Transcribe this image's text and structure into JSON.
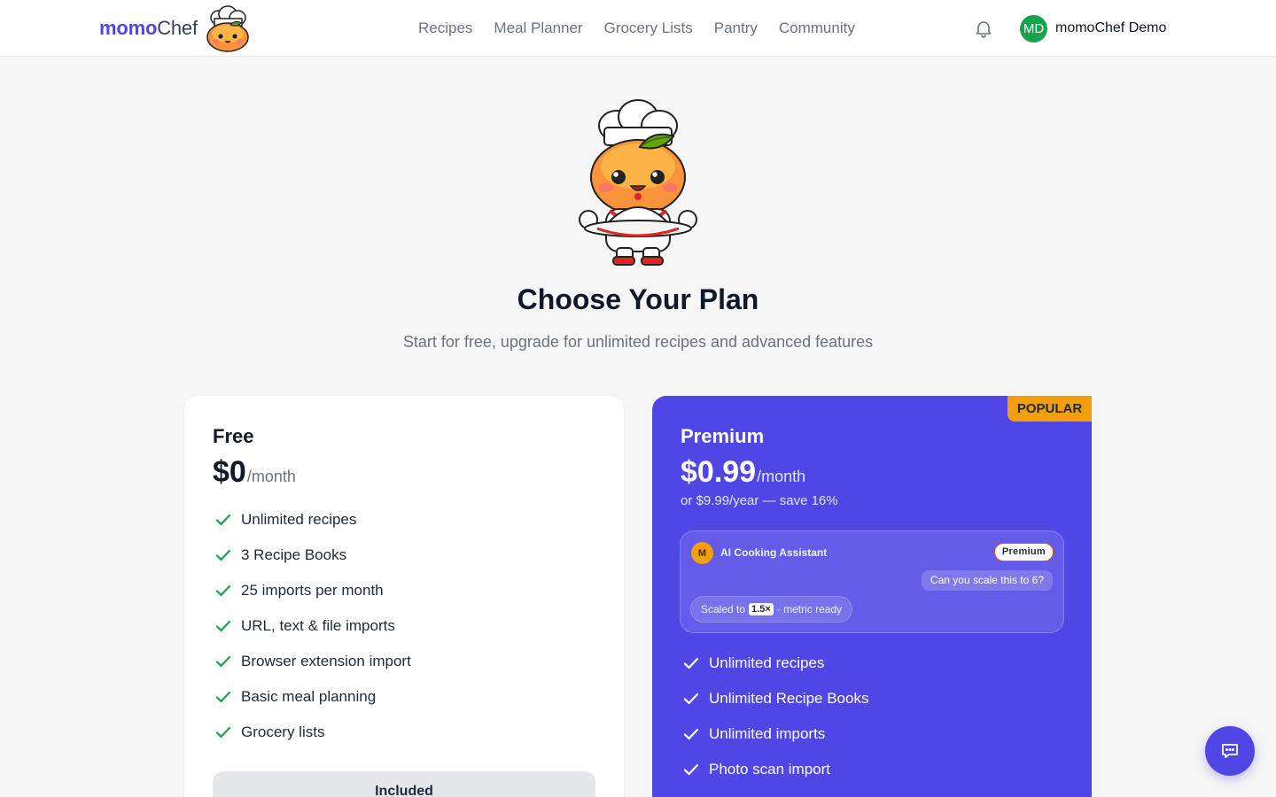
{
  "header": {
    "logo": {
      "part1": "momo",
      "part2": "Chef",
      "mascot_icon": "peach-chef-mascot-icon"
    },
    "nav": [
      {
        "label": "Recipes"
      },
      {
        "label": "Meal Planner"
      },
      {
        "label": "Grocery Lists"
      },
      {
        "label": "Pantry"
      },
      {
        "label": "Community"
      }
    ],
    "notification_icon": "bell-icon",
    "user": {
      "initials": "MD",
      "name": "momoChef Demo",
      "avatar_color": "#16a34a"
    }
  },
  "hero": {
    "mascot_icon": "peach-chef-holding-cloche-icon",
    "title": "Choose Your Plan",
    "subtitle": "Start for free, upgrade for unlimited recipes and advanced features"
  },
  "plans": [
    {
      "name": "Free",
      "price": "$0",
      "period": "/month",
      "features": [
        "Unlimited recipes",
        "3 Recipe Books",
        "25 imports per month",
        "URL, text & file imports",
        "Browser extension import",
        "Basic meal planning",
        "Grocery lists"
      ],
      "button_label": "Included"
    },
    {
      "name": "Premium",
      "badge": "POPULAR",
      "price": "$0.99",
      "period": "/month",
      "alt_price": "or $9.99/year — save 16%",
      "ai_preview": {
        "avatar_letter": "M",
        "title": "AI Cooking Assistant",
        "badge": "Premium",
        "question": "Can you scale this to 6?",
        "answer_prefix": "Scaled to",
        "answer_scale": "1.5×",
        "answer_suffix": "· metric ready"
      },
      "features": [
        "Unlimited recipes",
        "Unlimited Recipe Books",
        "Unlimited imports",
        "Photo scan import"
      ]
    }
  ],
  "chat_button_icon": "chat-bubble-icon",
  "colors": {
    "brand": "#4f46e5",
    "check_free": "#16a34a",
    "popular_badge": "#f59e0b",
    "page_bg": "#f6f6f6"
  }
}
